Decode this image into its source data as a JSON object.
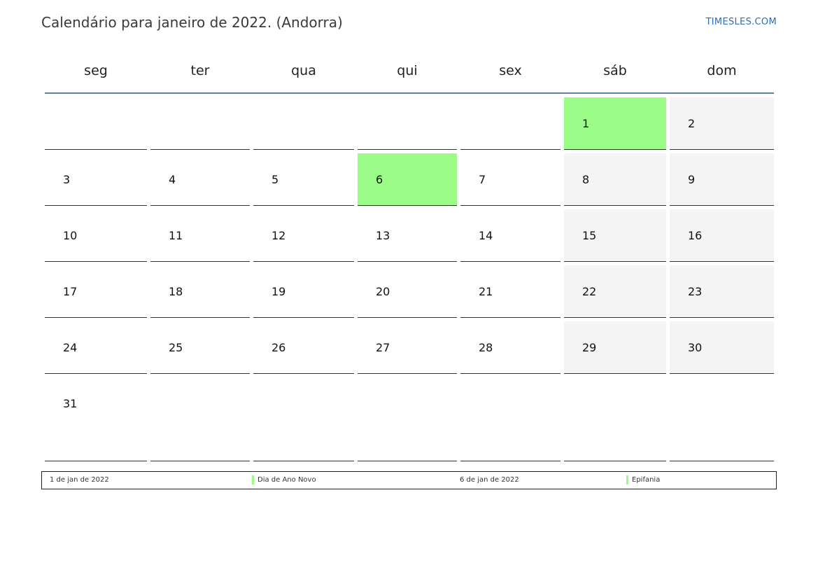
{
  "header": {
    "title": "Calendário para janeiro de 2022. (Andorra)",
    "brand": "TIMESLES.COM"
  },
  "weekdays": [
    "seg",
    "ter",
    "qua",
    "qui",
    "sex",
    "sáb",
    "dom"
  ],
  "weeks": [
    [
      "",
      "",
      "",
      "",
      "",
      "1",
      "2"
    ],
    [
      "3",
      "4",
      "5",
      "6",
      "7",
      "8",
      "9"
    ],
    [
      "10",
      "11",
      "12",
      "13",
      "14",
      "15",
      "16"
    ],
    [
      "17",
      "18",
      "19",
      "20",
      "21",
      "22",
      "23"
    ],
    [
      "24",
      "25",
      "26",
      "27",
      "28",
      "29",
      "30"
    ],
    [
      "31",
      "",
      "",
      "",
      "",
      "",
      ""
    ]
  ],
  "holiday_dates": [
    "1",
    "6"
  ],
  "holidays": [
    {
      "date": "1 de jan de 2022",
      "name": "Dia de Ano Novo"
    },
    {
      "date": "6 de jan de 2022",
      "name": "Epifania"
    }
  ],
  "colors": {
    "holiday": "#9cfc88",
    "weekend": "#f4f4f4",
    "header_rule": "#5b7fa5",
    "brand": "#2f6db5"
  }
}
